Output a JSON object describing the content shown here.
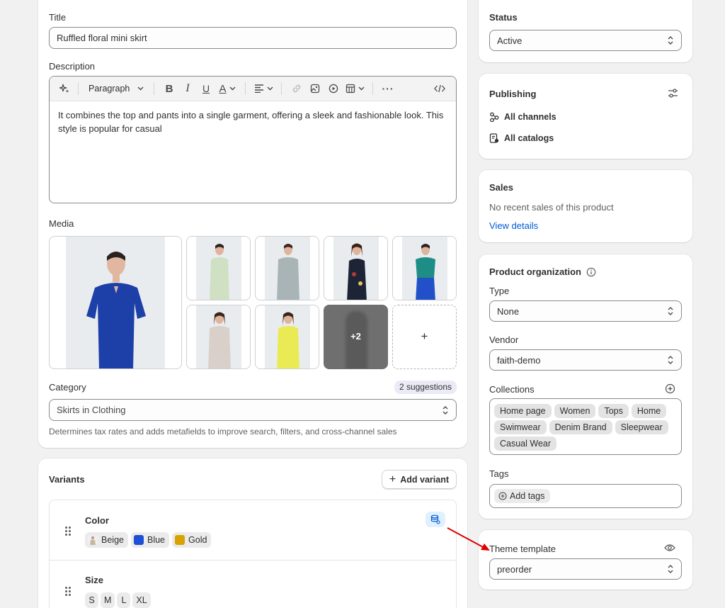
{
  "product": {
    "title_label": "Title",
    "title_value": "Ruffled floral mini skirt",
    "description_label": "Description",
    "toolbar": {
      "paragraph": "Paragraph"
    },
    "description_text": "It combines the top and pants into a single garment, offering a sleek and fashionable look. This style is popular for casual",
    "media_label": "Media",
    "media_more": "+2",
    "media_add": "+",
    "category_label": "Category",
    "category_suggestions": "2 suggestions",
    "category_value": "Skirts in Clothing",
    "category_help": "Determines tax rates and adds metafields to improve search, filters, and cross-channel sales"
  },
  "variants": {
    "title": "Variants",
    "add_button": "Add variant",
    "options": [
      {
        "name": "Color",
        "values": [
          "Beige",
          "Blue",
          "Gold"
        ]
      },
      {
        "name": "Size",
        "values": [
          "S",
          "M",
          "L",
          "XL"
        ]
      }
    ],
    "colors": {
      "Beige": "#c9b79c",
      "Blue": "#1f4fd6",
      "Gold": "#d8a300"
    }
  },
  "status": {
    "label": "Status",
    "value": "Active"
  },
  "publishing": {
    "title": "Publishing",
    "channels": "All channels",
    "catalogs": "All catalogs"
  },
  "sales": {
    "title": "Sales",
    "text": "No recent sales of this product",
    "link": "View details"
  },
  "organization": {
    "title": "Product organization",
    "type_label": "Type",
    "type_value": "None",
    "vendor_label": "Vendor",
    "vendor_value": "faith-demo",
    "collections_label": "Collections",
    "collections": [
      "Home page",
      "Women",
      "Tops",
      "Home",
      "Swimwear",
      "Denim Brand",
      "Sleepwear",
      "Casual Wear"
    ],
    "tags_label": "Tags",
    "tags_button": "Add tags"
  },
  "theme": {
    "label": "Theme template",
    "value": "preorder"
  },
  "annotation": {
    "arrow_color": "#e00000"
  },
  "colors": {
    "accent": "#005bd3",
    "background": "#f1f1f1",
    "border": "#8a8a8a"
  }
}
